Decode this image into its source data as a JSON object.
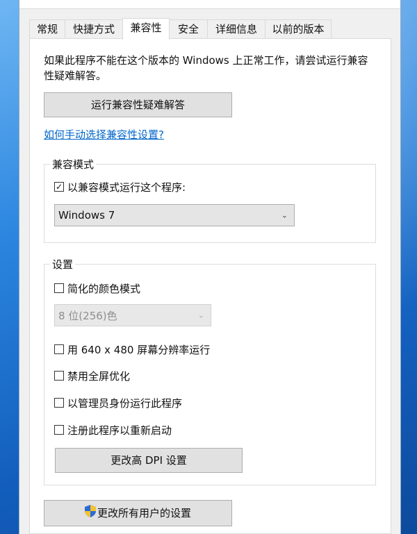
{
  "tabs": [
    {
      "label": "常规"
    },
    {
      "label": "快捷方式"
    },
    {
      "label": "兼容性"
    },
    {
      "label": "安全"
    },
    {
      "label": "详细信息"
    },
    {
      "label": "以前的版本"
    }
  ],
  "active_tab": "兼容性",
  "description": "如果此程序不能在这个版本的 Windows 上正常工作，请尝试运行兼容性疑难解答。",
  "troubleshoot_button": "运行兼容性疑难解答",
  "help_link": "如何手动选择兼容性设置?",
  "compat_mode": {
    "group_label": "兼容模式",
    "checkbox_label": "以兼容模式运行这个程序:",
    "checked": true,
    "selected_os": "Windows 7"
  },
  "settings": {
    "group_label": "设置",
    "reduced_color": {
      "label": "简化的颜色模式",
      "checked": false
    },
    "color_select": "8 位(256)色",
    "res_640": {
      "label": "用 640 x 480 屏幕分辨率运行",
      "checked": false
    },
    "disable_fullscreen": {
      "label": "禁用全屏优化",
      "checked": false
    },
    "run_as_admin": {
      "label": "以管理员身份运行此程序",
      "checked": false
    },
    "register_restart": {
      "label": "注册此程序以重新启动",
      "checked": false
    },
    "dpi_button": "更改高 DPI 设置"
  },
  "all_users_button": "更改所有用户的设置",
  "colors": {
    "link": "#0066cc",
    "button_bg": "#e1e1e1",
    "shield_blue": "#2b6bd6",
    "shield_yellow": "#f2c230"
  }
}
